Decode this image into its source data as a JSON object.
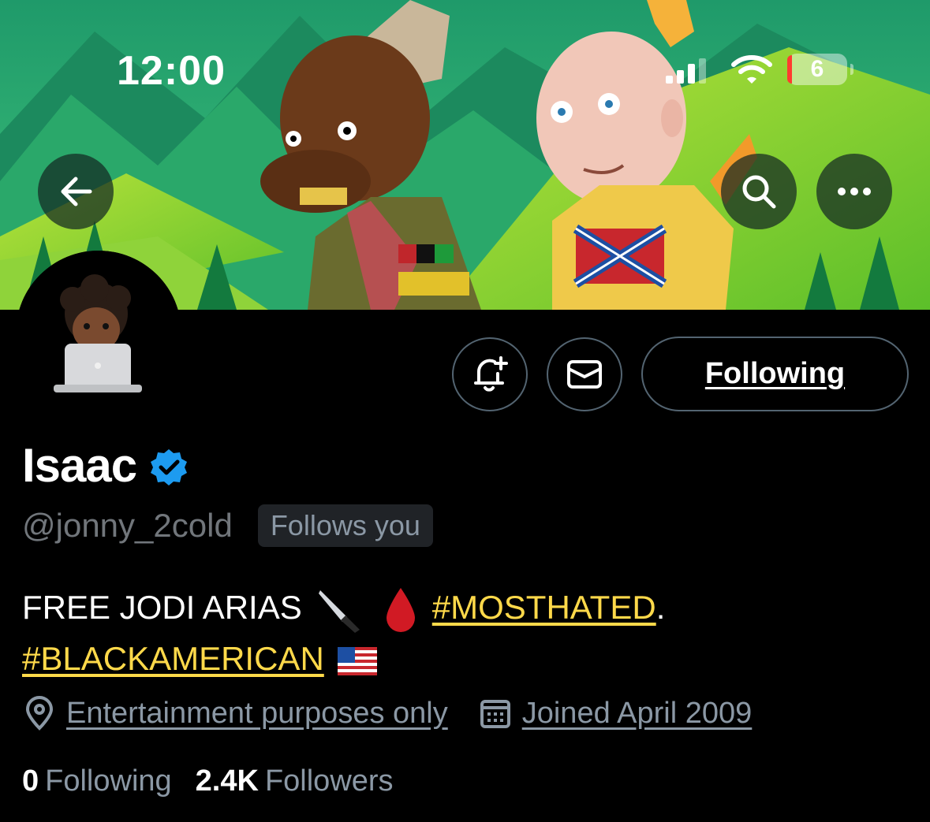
{
  "status_bar": {
    "time": "12:00",
    "battery_level": "6"
  },
  "profile": {
    "display_name": "Isaac",
    "handle": "@jonny_2cold",
    "follows_you_badge": "Follows you",
    "follow_button_label": "Following",
    "bio": {
      "line1_text": "FREE JODI ARIAS",
      "hashtag1": "#MOSTHATED",
      "hashtag1_suffix": ".",
      "hashtag2": "#BLACKAMERICAN"
    },
    "location": "Entertainment purposes only",
    "joined": "Joined April 2009",
    "following_count": "0",
    "following_label": "Following",
    "followers_count": "2.4K",
    "followers_label": "Followers"
  },
  "icons": {
    "back": "arrow-left-icon",
    "search": "search-icon",
    "more": "more-horizontal-icon",
    "notify": "bell-plus-icon",
    "message": "envelope-icon",
    "verified": "verified-badge-icon",
    "location": "location-pin-icon",
    "calendar": "calendar-icon"
  },
  "colors": {
    "background": "#000000",
    "hashtag": "#ffd94a",
    "muted_text": "#8b98a5",
    "verified_blue": "#1d9bf0",
    "button_border": "#536471"
  }
}
